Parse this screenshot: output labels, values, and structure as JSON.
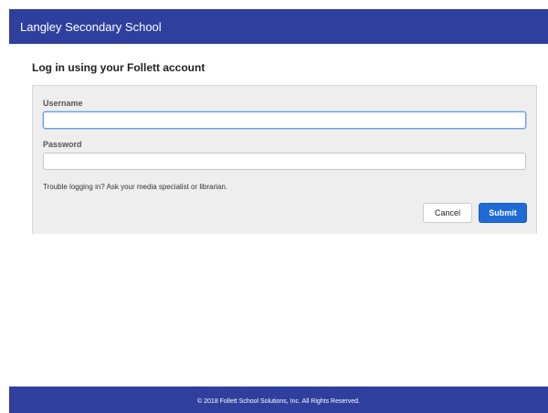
{
  "header": {
    "school_name": "Langley Secondary School"
  },
  "login": {
    "title": "Log in using your Follett account",
    "username": {
      "label": "Username",
      "value": "",
      "placeholder": ""
    },
    "password": {
      "label": "Password",
      "value": "",
      "placeholder": ""
    },
    "help_text": "Trouble logging in? Ask your media specialist or librarian.",
    "cancel_label": "Cancel",
    "submit_label": "Submit"
  },
  "footer": {
    "copyright": "© 2018 Follett School Solutions, Inc. All Rights Reserved."
  },
  "colors": {
    "brand": "#2f3f9e",
    "submit": "#1f6bd6",
    "panel": "#eeeeee"
  }
}
